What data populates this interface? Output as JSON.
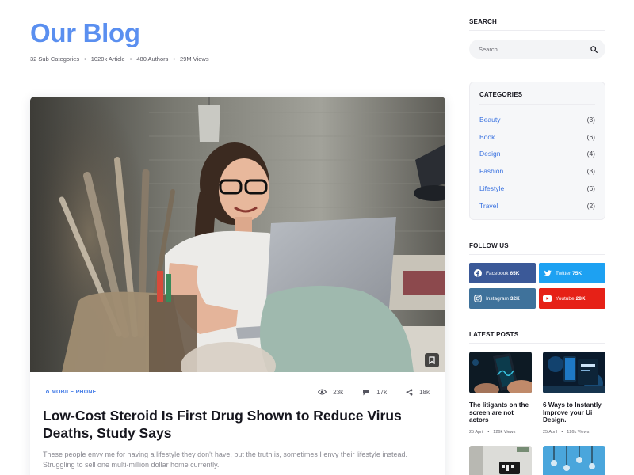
{
  "header": {
    "title": "Our Blog",
    "stats": [
      "32 Sub Categories",
      "1020k Article",
      "480 Authors",
      "29M Views"
    ]
  },
  "featured_post": {
    "category": "MOBILE PHONE",
    "views": "23k",
    "comments": "17k",
    "shares": "18k",
    "headline": "Low-Cost Steroid Is First Drug Shown to Reduce Virus Deaths, Study Says",
    "excerpt": "These people envy me for having a lifestyle they don't have, but the truth is, sometimes I envy their lifestyle instead. Struggling to sell one multi-million dollar home currently."
  },
  "sidebar": {
    "search": {
      "title": "SEARCH",
      "placeholder": "Search..."
    },
    "categories": {
      "title": "CATEGORIES",
      "items": [
        {
          "name": "Beauty",
          "count": "(3)"
        },
        {
          "name": "Book",
          "count": "(6)"
        },
        {
          "name": "Design",
          "count": "(4)"
        },
        {
          "name": "Fashion",
          "count": "(3)"
        },
        {
          "name": "Lifestyle",
          "count": "(6)"
        },
        {
          "name": "Travel",
          "count": "(2)"
        }
      ]
    },
    "follow": {
      "title": "FOLLOW US",
      "items": [
        {
          "network": "Facebook",
          "count": "65K",
          "color": "#3b5998",
          "icon": "facebook-icon"
        },
        {
          "network": "Twitter",
          "count": "75K",
          "color": "#1da1f2",
          "icon": "twitter-icon"
        },
        {
          "network": "Instagram",
          "count": "32K",
          "color": "#3f729b",
          "icon": "instagram-icon"
        },
        {
          "network": "Youtube",
          "count": "28K",
          "color": "#e62117",
          "icon": "youtube-icon"
        }
      ]
    },
    "latest": {
      "title": "LATEST POSTS",
      "posts": [
        {
          "title": "The litigants on the screen are not actors",
          "date": "25 April",
          "views": "126k Views"
        },
        {
          "title": "6 Ways to Instantly Improve your Ui Design.",
          "date": "25 April",
          "views": "126k Views"
        }
      ]
    }
  },
  "colors": {
    "accent": "#5a8ff0",
    "link": "#3a72e0"
  }
}
